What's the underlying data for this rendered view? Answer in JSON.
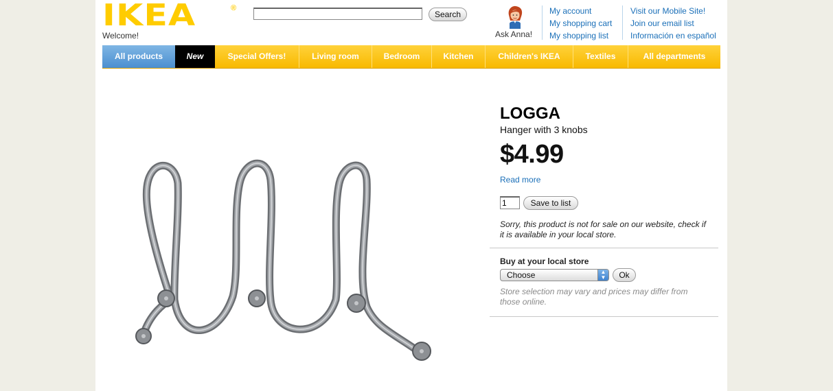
{
  "header": {
    "logo_text": "IKEA",
    "logo_reg": "®",
    "welcome": "Welcome!",
    "search": {
      "value": "",
      "button": "Search"
    },
    "ask_anna": "Ask Anna!",
    "account_links": [
      "My account",
      "My shopping cart",
      "My shopping list"
    ],
    "extra_links": [
      "Visit our Mobile Site!",
      "Join our email list",
      "Información en español"
    ]
  },
  "nav": {
    "items": [
      "All products",
      "New",
      "Special Offers!",
      "Living room",
      "Bedroom",
      "Kitchen",
      "Children's IKEA",
      "Textiles",
      "All departments"
    ]
  },
  "product": {
    "name": "LOGGA",
    "description": "Hanger with 3 knobs",
    "price": "$4.99",
    "read_more": "Read more",
    "quantity": "1",
    "save_button": "Save to list",
    "not_for_sale": "Sorry, this product is not for sale on our website, check if it is available in your local store."
  },
  "store": {
    "heading": "Buy at your local store",
    "selected": "Choose",
    "ok_button": "Ok",
    "note": "Store selection may vary and prices may differ from those online."
  },
  "colors": {
    "brand_yellow": "#ffcc00",
    "nav_active": "#4b8fd0",
    "link": "#1a6fb8",
    "background": "#efeee6"
  }
}
